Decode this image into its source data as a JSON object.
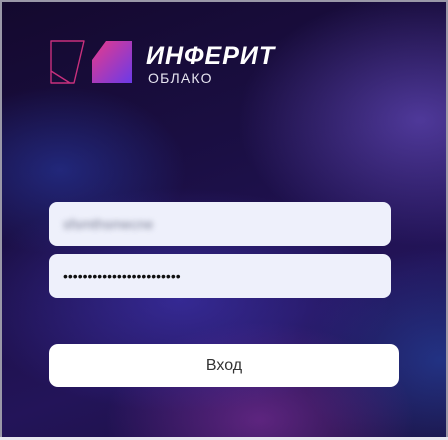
{
  "brand": {
    "title": "ИНФЕРИТ",
    "subtitle": "ОБЛАКО",
    "logo_icon": "inferit-logo-icon",
    "colors": {
      "pink": "#e83a8a",
      "purple": "#6b3ae8",
      "outline": "#d93a86"
    }
  },
  "login_form": {
    "login_value": "sfsmthsmecne",
    "password_value": "••••••••••••••••••••••••",
    "submit_label": "Вход"
  },
  "colors": {
    "field_bg": "#eef0fb",
    "button_bg": "#ffffff",
    "background_dark": "#1b0f45"
  }
}
